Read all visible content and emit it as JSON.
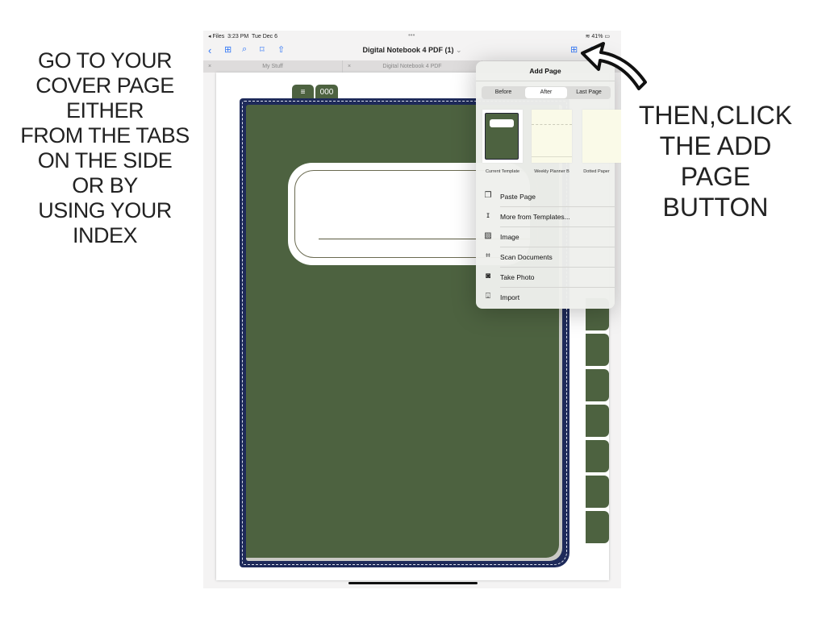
{
  "instructions": {
    "left": [
      "GO TO YOUR",
      "COVER PAGE",
      "EITHER",
      "FROM THE TABS",
      "ON THE SIDE",
      "OR BY",
      "USING YOUR",
      "INDEX"
    ],
    "right": [
      "THEN,CLICK",
      "THE ADD",
      "PAGE",
      "BUTTON"
    ]
  },
  "status": {
    "back": "◂ Files",
    "time": "3:23 PM",
    "date": "Tue Dec 6",
    "dots": "•••",
    "battery": "41%"
  },
  "toolbar": {
    "title": "Digital Notebook 4 PDF (1)",
    "title_chevron": "⌄"
  },
  "tabs": [
    {
      "label": "My Stuff"
    },
    {
      "label": "Digital Notebook 4 PDF"
    }
  ],
  "cover": {
    "top_tab_2": "000",
    "color": "#4d6240",
    "border_color": "#1e2a5a"
  },
  "popover": {
    "title": "Add Page",
    "segments": [
      "Before",
      "After",
      "Last Page"
    ],
    "selected": "After",
    "templates": [
      "Current Template",
      "Weekly Planner B",
      "Dotted Paper"
    ],
    "items": [
      {
        "label": "Paste Page",
        "icon": "paste-icon"
      },
      {
        "label": "More from Templates...",
        "icon": "templates-icon"
      },
      {
        "label": "Image",
        "icon": "image-icon"
      },
      {
        "label": "Scan Documents",
        "icon": "scan-icon"
      },
      {
        "label": "Take Photo",
        "icon": "camera-icon"
      },
      {
        "label": "Import",
        "icon": "import-icon"
      }
    ]
  }
}
